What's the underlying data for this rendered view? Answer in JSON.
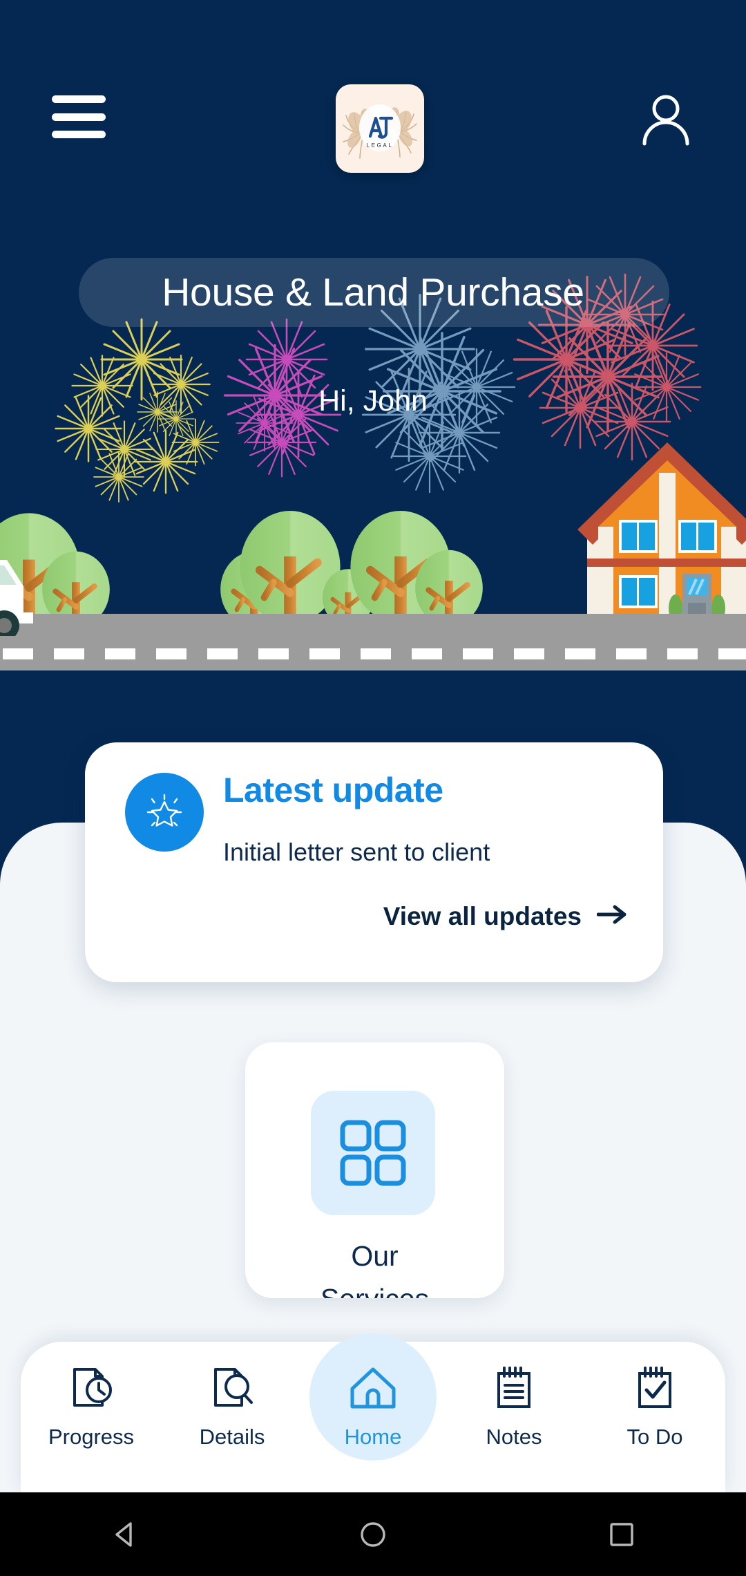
{
  "app": {
    "brand_name": "AJT",
    "brand_sub": "LEGAL",
    "background_navy": "#042851",
    "accent_blue": "#108ae4",
    "panel_bg": "#f2f6f9"
  },
  "header": {
    "menu_icon": "hamburger-menu-icon",
    "logo_icon": "ajt-legal-logo",
    "account_icon": "account-person-icon",
    "title": "House & Land Purchase",
    "greeting": "Hi, John"
  },
  "illustration": {
    "scene": "house-trees-road-truck",
    "house_body": "#f08c22",
    "house_roof": "#bf4f35",
    "house_trim": "#f5efe4",
    "window_color": "#17a1e0",
    "tree_foliage": "#9ad17a",
    "tree_trunk": "#c57a2c",
    "road_color": "#9c9c9c",
    "truck_color": "#ffffff",
    "fireworks": [
      {
        "color": "#e8d857",
        "name": "yellow-firework"
      },
      {
        "color": "#d94fc4",
        "name": "magenta-firework"
      },
      {
        "color": "#8fb8d8",
        "name": "lightblue-firework"
      },
      {
        "color": "#e05b6b",
        "name": "red-firework"
      }
    ]
  },
  "update_card": {
    "icon": "sparkle-star-icon",
    "title": "Latest update",
    "body": "Initial letter sent to client",
    "link_label": "View all updates",
    "link_icon": "arrow-right-icon"
  },
  "service_card": {
    "icon": "grid-four-squares-icon",
    "label_line1": "Our",
    "label_line2": "Services"
  },
  "bottom_nav": {
    "items": [
      {
        "label": "Progress",
        "icon": "document-clock-icon",
        "active": false
      },
      {
        "label": "Details",
        "icon": "document-search-icon",
        "active": false
      },
      {
        "label": "Home",
        "icon": "house-outline-icon",
        "active": true
      },
      {
        "label": "Notes",
        "icon": "notepad-lines-icon",
        "active": false
      },
      {
        "label": "To Do",
        "icon": "notepad-check-icon",
        "active": false
      }
    ]
  },
  "android_nav": {
    "back": "back-triangle-icon",
    "home": "home-circle-icon",
    "recents": "recents-square-icon"
  }
}
